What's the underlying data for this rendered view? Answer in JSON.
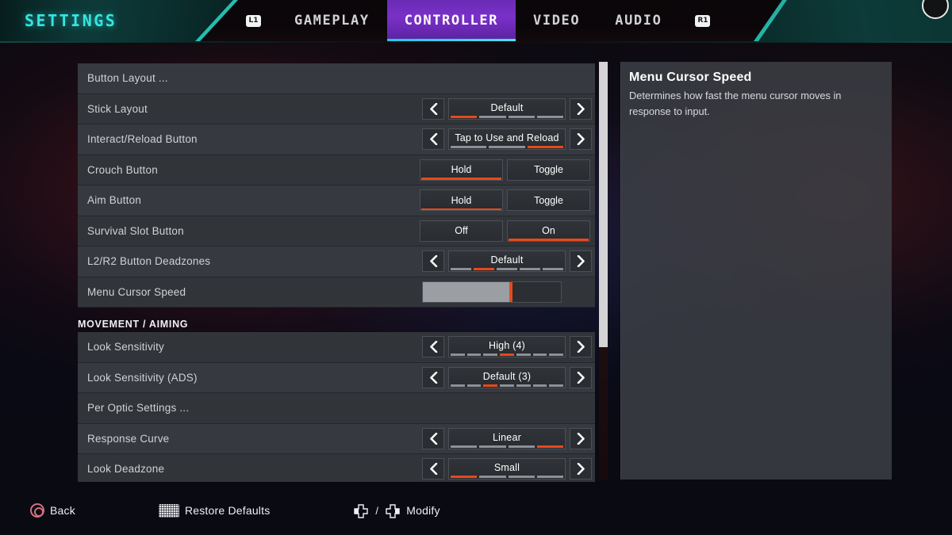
{
  "header": {
    "title": "SETTINGS",
    "left_key": "L1",
    "right_key": "R1",
    "tabs": [
      {
        "label": "GAMEPLAY",
        "active": false
      },
      {
        "label": "CONTROLLER",
        "active": true
      },
      {
        "label": "VIDEO",
        "active": false
      },
      {
        "label": "AUDIO",
        "active": false
      }
    ],
    "accent_active": "#7a30c8",
    "accent_underline": "#24c6e8",
    "title_color": "#35e6e0"
  },
  "settings": {
    "rows": [
      {
        "label": "Button Layout ...",
        "type": "link"
      },
      {
        "label": "Stick Layout",
        "type": "stepper",
        "value": "Default",
        "segments": 4,
        "active_segment": 1
      },
      {
        "label": "Interact/Reload Button",
        "type": "stepper",
        "value": "Tap to Use and Reload",
        "segments": 3,
        "active_segment": 3
      },
      {
        "label": "Crouch Button",
        "type": "optpair",
        "options": [
          "Hold",
          "Toggle"
        ],
        "selected": "Hold"
      },
      {
        "label": "Aim Button",
        "type": "optpair",
        "options": [
          "Hold",
          "Toggle"
        ],
        "selected": "Hold"
      },
      {
        "label": "Survival Slot Button",
        "type": "optpair",
        "options": [
          "Off",
          "On"
        ],
        "selected": "On"
      },
      {
        "label": "L2/R2 Button Deadzones",
        "type": "stepper",
        "value": "Default",
        "segments": 5,
        "active_segment": 2
      },
      {
        "label": "Menu Cursor Speed",
        "type": "slider",
        "percent": 64
      },
      {
        "label": "MOVEMENT / AIMING",
        "type": "section"
      },
      {
        "label": "Look Sensitivity",
        "type": "stepper",
        "value": "High  (4)",
        "segments": 7,
        "active_segment": 4
      },
      {
        "label": "Look Sensitivity  (ADS)",
        "type": "stepper",
        "value": "Default (3)",
        "segments": 7,
        "active_segment": 3
      },
      {
        "label": "Per Optic Settings ...",
        "type": "link"
      },
      {
        "label": "Response Curve",
        "type": "stepper",
        "value": "Linear",
        "segments": 4,
        "active_segment": 4
      },
      {
        "label": "Look Deadzone",
        "type": "stepper",
        "value": "Small",
        "segments": 4,
        "active_segment": 1
      }
    ],
    "segment_on_color": "#e8491b",
    "segment_off_color": "#8d9096"
  },
  "description": {
    "title": "Menu Cursor Speed",
    "body": "Determines how fast the menu cursor moves in response to input."
  },
  "footer": {
    "items": [
      {
        "label": "Back",
        "icon": "circle-button-icon"
      },
      {
        "label": "Restore Defaults",
        "icon": "touchpad-icon"
      },
      {
        "label": "Modify",
        "icon": "dpad-left-right-icon"
      }
    ],
    "modify_separator": "/"
  }
}
